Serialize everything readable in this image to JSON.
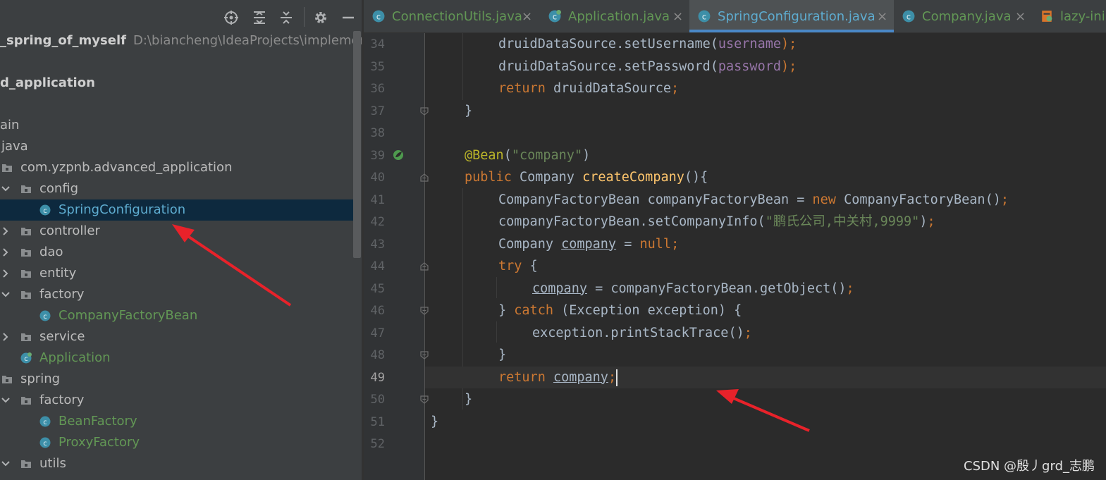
{
  "project_panel": {
    "tree": [
      {
        "label": "_spring_of_myself",
        "hint": "D:\\biancheng\\IdeaProjects\\implement-",
        "type": "module"
      },
      {
        "label": "d_application",
        "type": "module"
      },
      {
        "label": "",
        "type": "blank"
      },
      {
        "label": "ain",
        "type": "folder-plain"
      },
      {
        "label": "java",
        "type": "folder-plain"
      },
      {
        "label": "com.yzpnb.advanced_application",
        "type": "package"
      },
      {
        "label": "config",
        "type": "package"
      },
      {
        "label": "SpringConfiguration",
        "type": "class"
      },
      {
        "label": "controller",
        "type": "package"
      },
      {
        "label": "dao",
        "type": "package"
      },
      {
        "label": "entity",
        "type": "package"
      },
      {
        "label": "factory",
        "type": "package"
      },
      {
        "label": "CompanyFactoryBean",
        "type": "class"
      },
      {
        "label": "service",
        "type": "package"
      },
      {
        "label": "Application",
        "type": "class"
      },
      {
        "label": "spring",
        "type": "package"
      },
      {
        "label": "factory",
        "type": "package"
      },
      {
        "label": "BeanFactory",
        "type": "class"
      },
      {
        "label": "ProxyFactory",
        "type": "class"
      },
      {
        "label": "utils",
        "type": "package"
      }
    ],
    "toolbar_icons": [
      "locate-icon",
      "expand-all-icon",
      "collapse-all-icon",
      "gear-icon",
      "minimize-icon"
    ]
  },
  "tabs": [
    {
      "label": "ConnectionUtils.java",
      "close": "×"
    },
    {
      "label": "Application.java",
      "close": "×"
    },
    {
      "label": "SpringConfiguration.java",
      "close": "×",
      "active": true
    },
    {
      "label": "Company.java",
      "close": "×"
    },
    {
      "label": "lazy-ini"
    }
  ],
  "editor": {
    "line_numbers": [
      "34",
      "35",
      "36",
      "37",
      "38",
      "39",
      "40",
      "41",
      "42",
      "43",
      "44",
      "45",
      "46",
      "47",
      "48",
      "49",
      "50",
      "51",
      "52"
    ],
    "current_line": "49",
    "code": {
      "l34": {
        "a": "druidDataSource.setUsername(",
        "b": "username",
        "c": ");"
      },
      "l35": {
        "a": "druidDataSource.setPassword(",
        "b": "password",
        "c": ");"
      },
      "l36": {
        "kw": "return",
        "rest": " druidDataSource",
        "semi": ";"
      },
      "l37": "}",
      "l39": {
        "ann": "@Bean",
        "p1": "(",
        "str": "\"company\"",
        "p2": ")"
      },
      "l40": {
        "kw": "public",
        "type": " Company ",
        "fn": "createCompany",
        "rest": "(){"
      },
      "l41": {
        "a": "CompanyFactoryBean companyFactoryBean = ",
        "kw": "new",
        "b": " CompanyFactoryBean()",
        "semi": ";"
      },
      "l42": {
        "a": "companyFactoryBean.setCompanyInfo(",
        "str": "\"鹏氏公司,中关村,9999\"",
        "b": ")",
        "semi": ";"
      },
      "l43": {
        "a": "Company ",
        "var": "company",
        "b": " = ",
        "kw": "null",
        "semi": ";"
      },
      "l44": {
        "kw": "try",
        "rest": " {"
      },
      "l45": {
        "var": "company",
        "b": " = companyFactoryBean.getObject()",
        "semi": ";"
      },
      "l46": {
        "a": "} ",
        "kw": "catch",
        "rest": " (Exception exception) {"
      },
      "l47": {
        "a": "exception.printStackTrace()",
        "semi": ";"
      },
      "l48": "}",
      "l49": {
        "kw": "return",
        "sp": " ",
        "var": "company",
        "semi": ";"
      },
      "l50": "}",
      "l51": "}"
    }
  },
  "watermark": "CSDN @殷丿grd_志鹏",
  "colors": {
    "panel_bg": "#3c3f41",
    "editor_bg": "#2b2b2b",
    "selection": "#0d293e",
    "keyword": "#cc7832",
    "string": "#6a8759",
    "annotation": "#bbb529",
    "method": "#ffc66d",
    "field": "#9876aa",
    "arrow": "#e8222a"
  }
}
